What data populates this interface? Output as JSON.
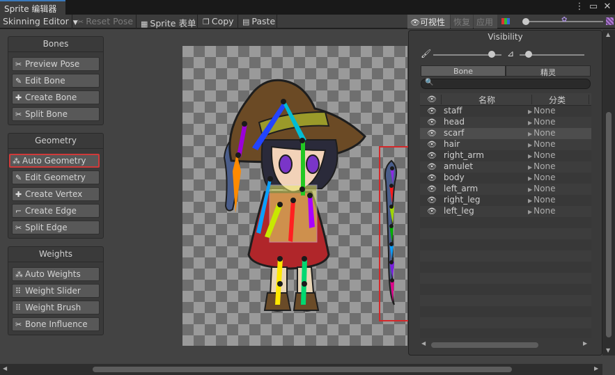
{
  "window": {
    "tab_title": "Sprite 编辑器",
    "menu_icon": "kebab-menu-icon",
    "maximize_icon": "maximize-icon",
    "close_icon": "close-icon"
  },
  "toolbar": {
    "mode": "Skinning Editor",
    "reset_pose": "Reset Pose",
    "sprite_table": "Sprite 表单",
    "copy": "Copy",
    "paste": "Paste",
    "visibility": "可视性",
    "restore": "恢复",
    "apply": "应用"
  },
  "panels": {
    "bones": {
      "title": "Bones",
      "buttons": [
        "Preview Pose",
        "Edit Bone",
        "Create Bone",
        "Split Bone"
      ]
    },
    "geometry": {
      "title": "Geometry",
      "buttons": [
        "Auto Geometry",
        "Edit Geometry",
        "Create Vertex",
        "Create Edge",
        "Split Edge"
      ],
      "selected": "Auto Geometry"
    },
    "weights": {
      "title": "Weights",
      "buttons": [
        "Auto Weights",
        "Weight Slider",
        "Weight Brush",
        "Bone Influence"
      ]
    }
  },
  "visibility_panel": {
    "title": "Visibility",
    "tabs": [
      "Bone",
      "精灵"
    ],
    "active_tab": "Bone",
    "search_placeholder": "",
    "columns": {
      "name": "名称",
      "category": "分类"
    },
    "rows": [
      {
        "name": "staff",
        "category": "None"
      },
      {
        "name": "head",
        "category": "None"
      },
      {
        "name": "scarf",
        "category": "None"
      },
      {
        "name": "hair",
        "category": "None"
      },
      {
        "name": "right_arm",
        "category": "None"
      },
      {
        "name": "amulet",
        "category": "None"
      },
      {
        "name": "body",
        "category": "None"
      },
      {
        "name": "left_arm",
        "category": "None"
      },
      {
        "name": "right_leg",
        "category": "None"
      },
      {
        "name": "left_leg",
        "category": "None"
      }
    ],
    "highlighted_row": "scarf",
    "bone_opacity": 0.9,
    "sprite_opacity": 0.1
  },
  "toolbar_opacity": 0.05,
  "colors": {
    "accent_blue": "#3a79bb",
    "selection_red": "#d03a3a",
    "panel_bg": "#3a3a3a",
    "canvas_bg": "#434343"
  }
}
